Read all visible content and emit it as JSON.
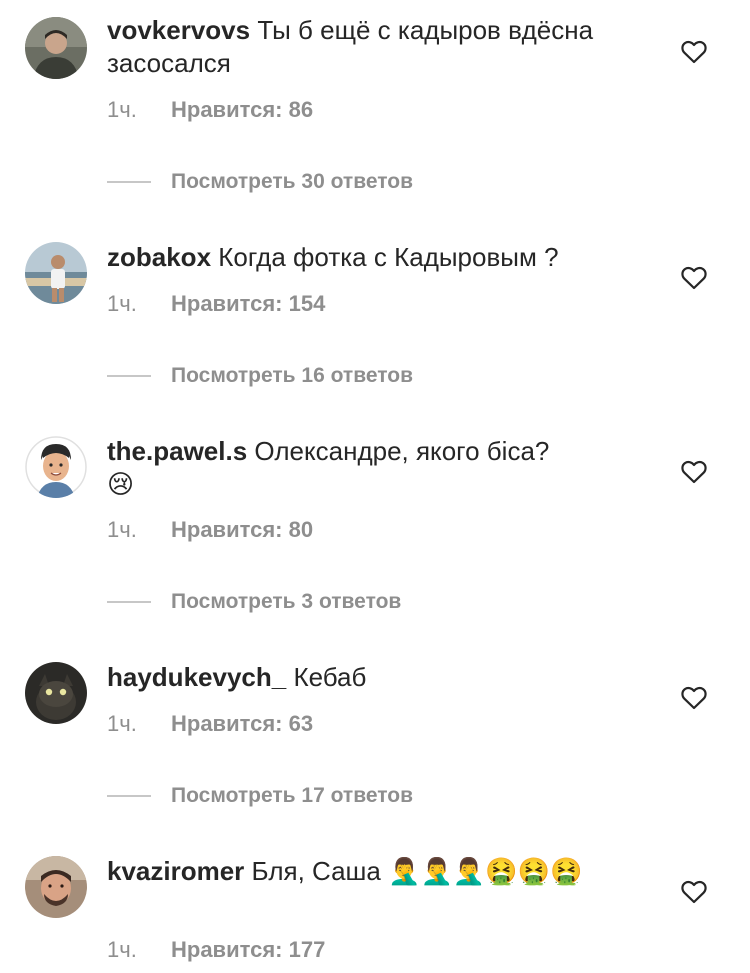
{
  "comments": [
    {
      "username": "vovkervovs",
      "text": "Ты б ещё с кадыров вдёсна засосался",
      "time": "1ч.",
      "likes": "Нравится: 86",
      "replies": "Посмотреть 30 ответов",
      "emoji": ""
    },
    {
      "username": "zobakox",
      "text": "Когда фотка с Кадыровым ?",
      "time": "1ч.",
      "likes": "Нравится: 154",
      "replies": "Посмотреть 16 ответов",
      "emoji": ""
    },
    {
      "username": "the.pawel.s",
      "text": "Олександре, якого біса?",
      "time": "1ч.",
      "likes": "Нравится: 80",
      "replies": "Посмотреть 3 ответов",
      "emoji": "😢"
    },
    {
      "username": "haydukevych_",
      "text": "Кебаб",
      "time": "1ч.",
      "likes": "Нравится: 63",
      "replies": "Посмотреть 17 ответов",
      "emoji": ""
    },
    {
      "username": "kvaziromer",
      "text": "Бля, Саша",
      "time": "1ч.",
      "likes": "Нравится: 177",
      "replies": "",
      "emoji": "🤦‍♂️🤦‍♂️🤦‍♂️🤮🤮🤮"
    }
  ],
  "icons": {
    "like": "heart-outline-icon"
  },
  "colors": {
    "text": "#262626",
    "secondary": "#8e8e8e",
    "divider": "#c7c7c7"
  }
}
